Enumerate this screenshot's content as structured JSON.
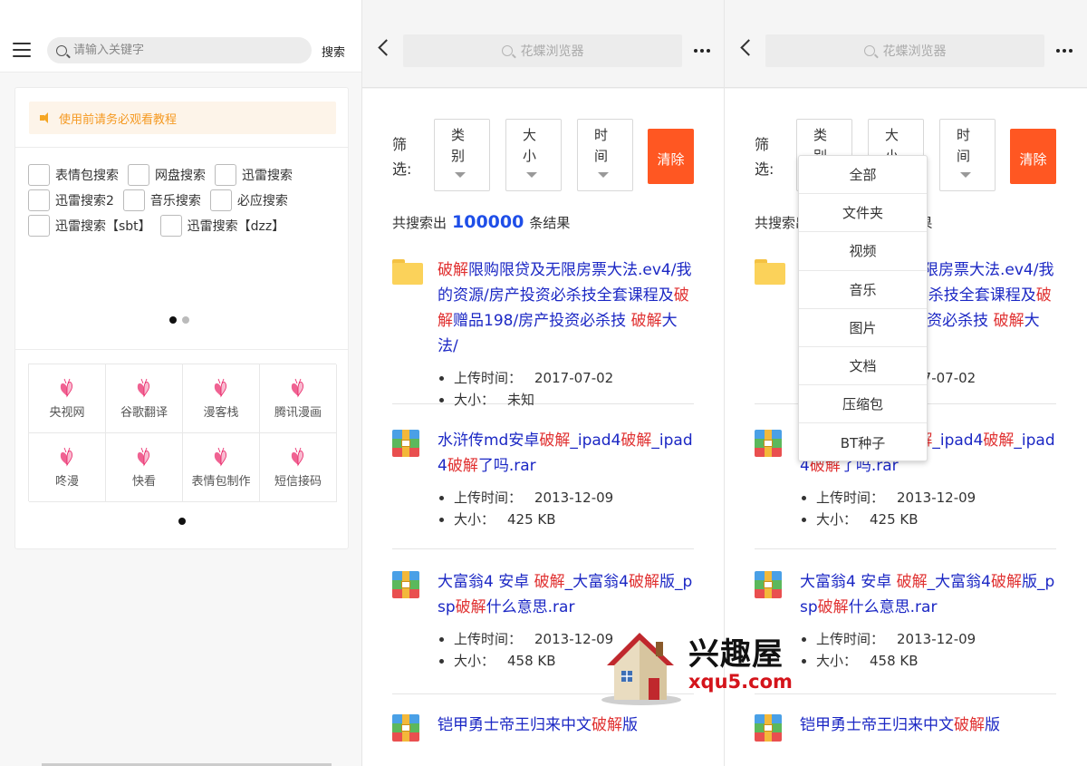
{
  "screen1": {
    "search_placeholder": "请输入关键字",
    "search_button": "搜索",
    "notice": "使用前请务必观看教程",
    "checkbox_rows": [
      [
        "表情包搜索",
        "网盘搜索",
        "迅雷搜索"
      ],
      [
        "迅雷搜索2",
        "音乐搜索",
        "必应搜索"
      ],
      [
        "迅雷搜索【sbt】",
        "迅雷搜索【dzz】"
      ]
    ],
    "sites": [
      "央视网",
      "谷歌翻译",
      "漫客栈",
      "腾讯漫画",
      "咚漫",
      "快看",
      "表情包制作",
      "短信接码"
    ]
  },
  "browser": {
    "title": "花蝶浏览器",
    "filter_label": "筛选:",
    "filters": [
      "类别",
      "大小",
      "时间"
    ],
    "clear": "清除",
    "count_prefix": "共搜索出",
    "count_value": "100000",
    "count_suffix": "条结果",
    "meta_labels": {
      "upload": "上传时间：",
      "size": "大小："
    }
  },
  "results": [
    {
      "icon": "folder-icon",
      "title_parts": [
        [
          "破解",
          true
        ],
        [
          "限购限贷及无限房票大法.ev4/我的资源/房产投资必杀技全套课程及",
          false
        ],
        [
          "破解",
          true
        ],
        [
          "赠品198/房产投资必杀技 ",
          false
        ],
        [
          "破解",
          true
        ],
        [
          "大法/",
          false
        ]
      ],
      "upload_time": "2017-07-02",
      "size": "未知"
    },
    {
      "icon": "rar-icon",
      "title_parts": [
        [
          "水浒传md安卓",
          false
        ],
        [
          "破解",
          true
        ],
        [
          "_ipad4",
          false
        ],
        [
          "破解",
          true
        ],
        [
          "_ipad4",
          false
        ],
        [
          "破解",
          true
        ],
        [
          "了吗.rar",
          false
        ]
      ],
      "upload_time": "2013-12-09",
      "size": "425 KB"
    },
    {
      "icon": "rar-icon",
      "title_parts": [
        [
          "大富翁4 安卓 ",
          false
        ],
        [
          "破解",
          true
        ],
        [
          "_大富翁4",
          false
        ],
        [
          "破解",
          true
        ],
        [
          "版_psp",
          false
        ],
        [
          "破解",
          true
        ],
        [
          "什么意思.rar",
          false
        ]
      ],
      "upload_time": "2013-12-09",
      "size": "458 KB"
    },
    {
      "icon": "rar-icon",
      "title_parts": [
        [
          "铠甲勇士帝王归来中文",
          false
        ],
        [
          "破解",
          true
        ],
        [
          "版",
          false
        ]
      ],
      "upload_time": "",
      "size": ""
    }
  ],
  "dropdown": [
    "全部",
    "文件夹",
    "视频",
    "音乐",
    "图片",
    "文档",
    "压缩包",
    "BT种子"
  ],
  "watermark": {
    "brand": "兴趣屋",
    "domain": "xqu5.com"
  },
  "colors": {
    "accent_orange": "#ff5722",
    "link_blue": "#1b27c4",
    "highlight_red": "#e03030",
    "count_blue": "#1e4ee8",
    "notice_orange": "#f59a23"
  }
}
